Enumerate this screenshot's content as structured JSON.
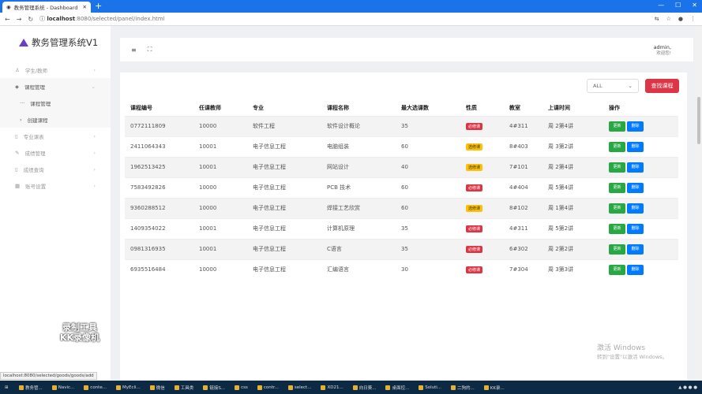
{
  "browser": {
    "tab_title": "教务管理系统 - Dashboard",
    "url_host": "localhost",
    "url_path": ":8080/selected/panel/index.html"
  },
  "sidebar": {
    "logo": "教务管理系统V1",
    "items": [
      {
        "label": "学生/教师",
        "icon": "user-icon"
      },
      {
        "label": "课程管理",
        "icon": "layers-icon",
        "open": true
      },
      {
        "label": "课程管理",
        "sub": true
      },
      {
        "label": "创建课程",
        "sub": true
      },
      {
        "label": "专业课表",
        "icon": "file-icon"
      },
      {
        "label": "成绩管理",
        "icon": "edit-icon"
      },
      {
        "label": "成绩查询",
        "icon": "file-icon"
      },
      {
        "label": "账号设置",
        "icon": "grid-icon"
      }
    ]
  },
  "header": {
    "user": "admin,",
    "welcome": "欢迎您!"
  },
  "toolbar": {
    "filter_value": "ALL",
    "find_label": "查找课程"
  },
  "table": {
    "columns": [
      "课程编号",
      "任课教师",
      "专业",
      "课程名称",
      "最大选课数",
      "性质",
      "教室",
      "上课时间",
      "操作"
    ],
    "update_label": "更新",
    "delete_label": "删除",
    "rows": [
      [
        "0772111809",
        "10000",
        "软件工程",
        "软件设计概论",
        "35",
        "必修课",
        "4#311",
        "周 2第4讲"
      ],
      [
        "2411064343",
        "10001",
        "电子信息工程",
        "电脑组装",
        "60",
        "选修课",
        "8#403",
        "周 3第2讲"
      ],
      [
        "1962513425",
        "10001",
        "电子信息工程",
        "网站设计",
        "40",
        "选修课",
        "7#101",
        "周 2第4讲"
      ],
      [
        "7583492826",
        "10000",
        "电子信息工程",
        "PCB 技术",
        "60",
        "必修课",
        "4#404",
        "周 5第4讲"
      ],
      [
        "9360288512",
        "10000",
        "电子信息工程",
        "焊接工艺欣赏",
        "60",
        "选修课",
        "8#102",
        "周 1第4讲"
      ],
      [
        "1409354022",
        "10001",
        "电子信息工程",
        "计算机原理",
        "35",
        "必修课",
        "4#311",
        "周 5第2讲"
      ],
      [
        "0981316935",
        "10001",
        "电子信息工程",
        "C语言",
        "35",
        "必修课",
        "6#302",
        "周 2第2讲"
      ],
      [
        "6935516484",
        "10000",
        "电子信息工程",
        "汇编语言",
        "30",
        "必修课",
        "7#304",
        "周 3第3讲"
      ]
    ]
  },
  "status_url": "localhost:8080/selected/goods/goods/add",
  "watermark": {
    "line1": "激活 Windows",
    "line2": "转到\"设置\"以激活 Windows。"
  },
  "recorder": {
    "line1": "录制工具",
    "line2": "KK录像机"
  },
  "taskbar": [
    "教务管...",
    "Navic...",
    "conte...",
    "MyEcli...",
    "微信",
    "工具类",
    "链接S...",
    "css",
    "contr...",
    "select...",
    "XD21...",
    "向日葵...",
    "桌面控...",
    "Soluti...",
    "二狗的...",
    "KK录..."
  ],
  "colors": {
    "tabbar": "#1a73e8",
    "danger": "#dc3545",
    "success": "#28a745",
    "primary": "#007bff",
    "warning": "#ffc107"
  }
}
